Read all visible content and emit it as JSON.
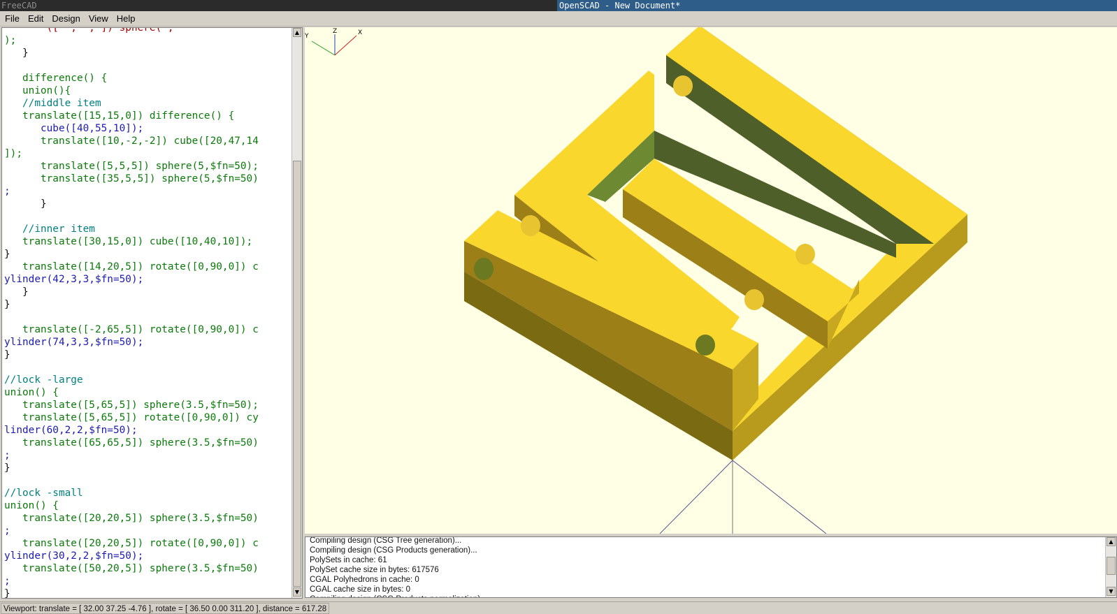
{
  "titlebar": {
    "left_title": "FreeCAD",
    "right_title": "OpenSCAD - New Document*"
  },
  "menu": [
    "File",
    "Edit",
    "Design",
    "View",
    "Help"
  ],
  "editor": {
    "lines": [
      {
        "t": "       ([  ,  , ]) sphere( ,",
        "c": "num"
      },
      {
        "t": ");",
        "c": "kw"
      },
      {
        "t": "   }",
        "c": "plain"
      },
      {
        "t": "",
        "c": "plain"
      },
      {
        "t": "   difference() {",
        "c": "kw"
      },
      {
        "t": "   union(){",
        "c": "kw"
      },
      {
        "t": "   //middle item",
        "c": "comment"
      },
      {
        "t": "   translate([15,15,0]) difference() {",
        "c": "kw"
      },
      {
        "t": "      cube([40,55,10]);",
        "c": "call"
      },
      {
        "t": "      translate([10,-2,-2]) cube([20,47,14",
        "c": "kw"
      },
      {
        "t": "]);",
        "c": "kw"
      },
      {
        "t": "      translate([5,5,5]) sphere(5,$fn=50);",
        "c": "kw"
      },
      {
        "t": "      translate([35,5,5]) sphere(5,$fn=50)",
        "c": "kw"
      },
      {
        "t": ";",
        "c": "call"
      },
      {
        "t": "      }",
        "c": "plain"
      },
      {
        "t": "",
        "c": "plain"
      },
      {
        "t": "   //inner item",
        "c": "comment"
      },
      {
        "t": "   translate([30,15,0]) cube([10,40,10]);",
        "c": "kw"
      },
      {
        "t": "}",
        "c": "plain"
      },
      {
        "t": "   translate([14,20,5]) rotate([0,90,0]) c",
        "c": "kw"
      },
      {
        "t": "ylinder(42,3,3,$fn=50);",
        "c": "call"
      },
      {
        "t": "   }",
        "c": "plain"
      },
      {
        "t": "}",
        "c": "plain"
      },
      {
        "t": "",
        "c": "plain"
      },
      {
        "t": "   translate([-2,65,5]) rotate([0,90,0]) c",
        "c": "kw"
      },
      {
        "t": "ylinder(74,3,3,$fn=50);",
        "c": "call"
      },
      {
        "t": "}",
        "c": "plain"
      },
      {
        "t": "",
        "c": "plain"
      },
      {
        "t": "//lock -large",
        "c": "comment"
      },
      {
        "t": "union() {",
        "c": "kw"
      },
      {
        "t": "   translate([5,65,5]) sphere(3.5,$fn=50);",
        "c": "kw"
      },
      {
        "t": "   translate([5,65,5]) rotate([0,90,0]) cy",
        "c": "kw"
      },
      {
        "t": "linder(60,2,2,$fn=50);",
        "c": "call"
      },
      {
        "t": "   translate([65,65,5]) sphere(3.5,$fn=50)",
        "c": "kw"
      },
      {
        "t": ";",
        "c": "call"
      },
      {
        "t": "}",
        "c": "plain"
      },
      {
        "t": "",
        "c": "plain"
      },
      {
        "t": "//lock -small",
        "c": "comment"
      },
      {
        "t": "union() {",
        "c": "kw"
      },
      {
        "t": "   translate([20,20,5]) sphere(3.5,$fn=50)",
        "c": "kw"
      },
      {
        "t": ";",
        "c": "call"
      },
      {
        "t": "   translate([20,20,5]) rotate([0,90,0]) c",
        "c": "kw"
      },
      {
        "t": "ylinder(30,2,2,$fn=50);",
        "c": "call"
      },
      {
        "t": "   translate([50,20,5]) sphere(3.5,$fn=50)",
        "c": "kw"
      },
      {
        "t": ";",
        "c": "call"
      },
      {
        "t": "}",
        "c": "plain"
      }
    ]
  },
  "viewport": {
    "axis_labels": {
      "x": "X",
      "y": "Y",
      "z": "Z"
    },
    "model_color": "#f9d72c",
    "background_color": "#ffffe6"
  },
  "console": {
    "lines": [
      "Compiling design (CSG Tree generation)...",
      "Compiling design (CSG Products generation)...",
      "PolySets in cache: 61",
      "PolySet cache size in bytes: 617576",
      "CGAL Polyhedrons in cache: 0",
      "CGAL cache size in bytes: 0",
      "Compiling design (CSG Products normalization)..."
    ]
  },
  "statusbar": {
    "text": "Viewport: translate = [ 32.00 37.25 -4.76 ], rotate = [ 36.50 0.00 311.20 ], distance = 617.28"
  }
}
